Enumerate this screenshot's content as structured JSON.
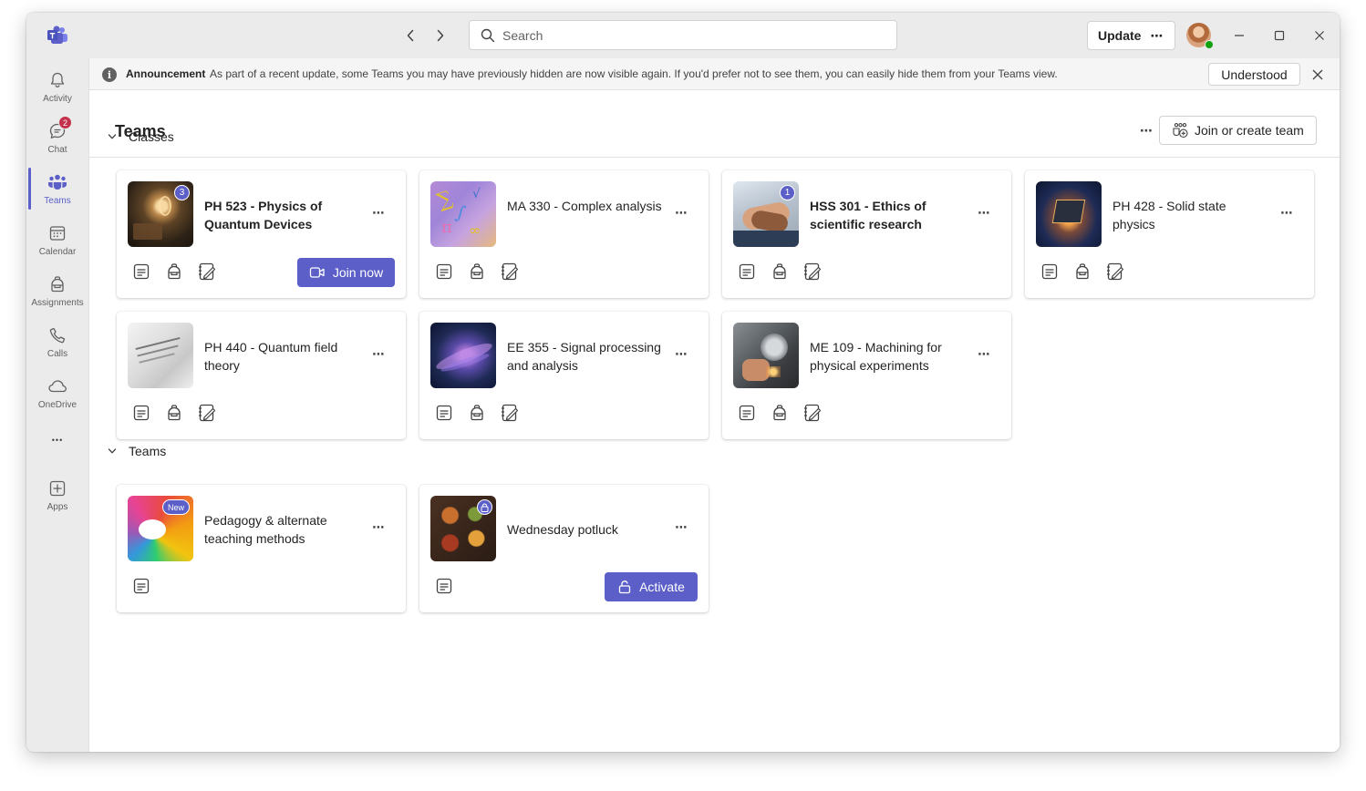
{
  "titlebar": {
    "search_placeholder": "Search",
    "update_label": "Update",
    "update_more": "⋯"
  },
  "rail": {
    "items": [
      {
        "label": "Activity",
        "icon": "bell-icon"
      },
      {
        "label": "Chat",
        "icon": "chat-icon",
        "badge": "2"
      },
      {
        "label": "Teams",
        "icon": "teams-icon",
        "active": true
      },
      {
        "label": "Calendar",
        "icon": "calendar-icon"
      },
      {
        "label": "Assignments",
        "icon": "backpack-icon"
      },
      {
        "label": "Calls",
        "icon": "phone-icon"
      },
      {
        "label": "OneDrive",
        "icon": "cloud-icon"
      },
      {
        "label": "•••",
        "icon": "more-icon"
      },
      {
        "label": "Apps",
        "icon": "add-apps-icon"
      }
    ]
  },
  "banner": {
    "title": "Announcement",
    "message": "As part of a recent update, some Teams you may have previously hidden are now visible again. If you'd prefer not to see them, you can easily hide them from your Teams view.",
    "understood_label": "Understood"
  },
  "header": {
    "title": "Teams",
    "more": "⋯",
    "join_create_label": "Join or create team"
  },
  "sections": {
    "classes_label": "Classes",
    "teams_label": "Teams"
  },
  "classes": [
    {
      "name": "PH 523 - Physics of Quantum Devices",
      "bold": true,
      "badge": "3",
      "cta": "Join now"
    },
    {
      "name": "MA 330 - Complex analysis",
      "bold": false
    },
    {
      "name": "HSS 301 - Ethics of scientific research",
      "bold": true,
      "badge": "1"
    },
    {
      "name": "PH 428 - Solid state physics",
      "bold": false
    },
    {
      "name": "PH 440 - Quantum field theory",
      "bold": false
    },
    {
      "name": "EE 355 - Signal processing and analysis",
      "bold": false
    },
    {
      "name": "ME 109 - Machining for physical experiments",
      "bold": false
    }
  ],
  "teams": [
    {
      "name": "Pedagogy & alternate teaching methods",
      "bold": false,
      "badge": "New"
    },
    {
      "name": "Wednesday potluck",
      "bold": false,
      "badge_icon": "lock-icon",
      "cta": "Activate"
    }
  ],
  "colors": {
    "accent": "#5b5fc7",
    "badge_red": "#c4314b",
    "presence_green": "#13a10e"
  }
}
